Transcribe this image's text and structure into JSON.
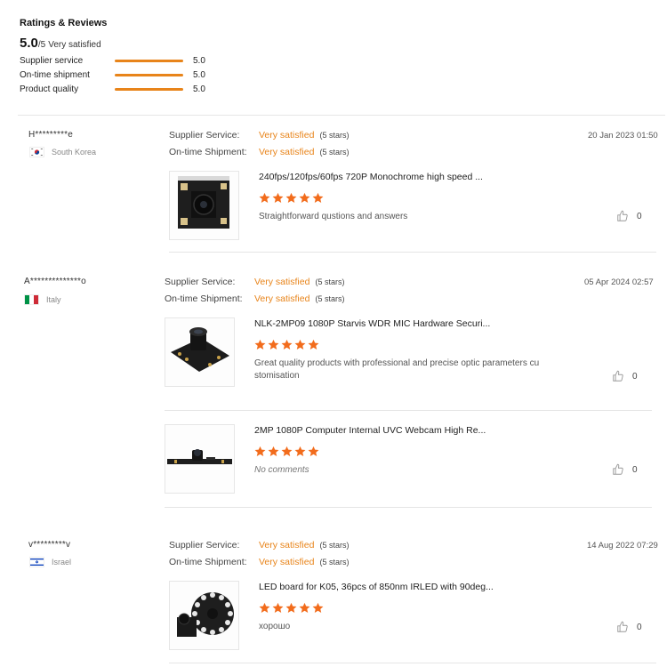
{
  "summary": {
    "title": "Ratings & Reviews",
    "score": "5.0",
    "score_suffix": "/5",
    "score_label": "Very satisfied",
    "metrics": [
      {
        "label": "Supplier service",
        "value": "5.0",
        "fraction": 1.0
      },
      {
        "label": "On-time shipment",
        "value": "5.0",
        "fraction": 1.0
      },
      {
        "label": "Product quality",
        "value": "5.0",
        "fraction": 1.0
      }
    ]
  },
  "colors": {
    "accent": "#e8841a",
    "star": "#f26c1c"
  },
  "reviews": [
    {
      "reviewer": "H*********e",
      "country": "South Korea",
      "flag_icon": "south-korea-flag-icon",
      "supplier_service_label": "Supplier Service:",
      "supplier_service_value": "Very satisfied",
      "supplier_service_stars": "(5 stars)",
      "shipment_label": "On-time Shipment:",
      "shipment_value": "Very satisfied",
      "shipment_stars": "(5 stars)",
      "date": "20 Jan 2023 01:50",
      "products": [
        {
          "title": "240fps/120fps/60fps 720P Monochrome high speed ...",
          "rating": 5,
          "comment": "Straightforward qustions and answers",
          "likes": "0"
        }
      ]
    },
    {
      "reviewer": "A**************o",
      "country": "Italy",
      "flag_icon": "italy-flag-icon",
      "supplier_service_label": "Supplier Service:",
      "supplier_service_value": "Very satisfied",
      "supplier_service_stars": "(5 stars)",
      "shipment_label": "On-time Shipment:",
      "shipment_value": "Very satisfied",
      "shipment_stars": "(5 stars)",
      "date": "05 Apr 2024 02:57",
      "products": [
        {
          "title": "NLK-2MP09 1080P Starvis WDR MIC Hardware Securi...",
          "rating": 5,
          "comment": "Great quality products with professional and precise optic parameters cu stomisation",
          "likes": "0"
        },
        {
          "title": "2MP 1080P Computer Internal UVC Webcam High Re...",
          "rating": 5,
          "comment": "No comments",
          "likes": "0"
        }
      ]
    },
    {
      "reviewer": "v*********v",
      "country": "Israel",
      "flag_icon": "israel-flag-icon",
      "supplier_service_label": "Supplier Service:",
      "supplier_service_value": "Very satisfied",
      "supplier_service_stars": "(5 stars)",
      "shipment_label": "On-time Shipment:",
      "shipment_value": "Very satisfied",
      "shipment_stars": "(5 stars)",
      "date": "14 Aug 2022 07:29",
      "products": [
        {
          "title": "LED board for K05, 36pcs of 850nm IRLED with 90deg...",
          "rating": 5,
          "comment": "хорошо",
          "likes": "0"
        }
      ]
    }
  ]
}
